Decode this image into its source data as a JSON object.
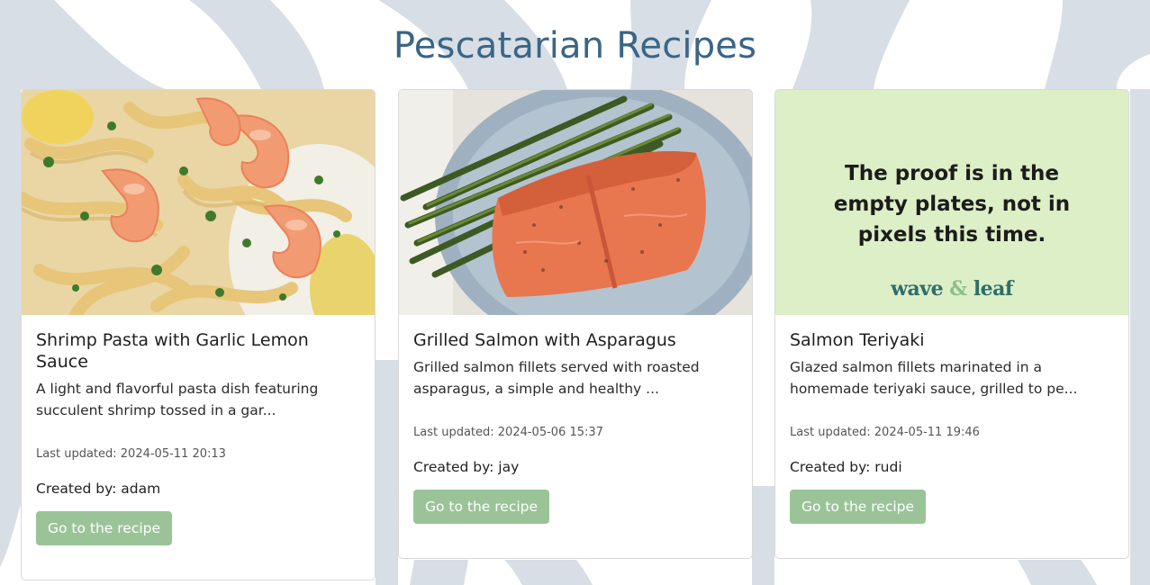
{
  "page": {
    "title": "Pescatarian Recipes"
  },
  "colors": {
    "title": "#3a6587",
    "button": "#9ac498",
    "swoosh": "#d8dee5",
    "promo_bg": "#ddefc6",
    "logo": "#2f6d6d"
  },
  "recipes": [
    {
      "title": "Shrimp Pasta with Garlic Lemon Sauce",
      "description": "A light and flavorful pasta dish featuring succulent shrimp tossed in a gar...",
      "last_updated": "Last updated: 2024-05-11 20:13",
      "created_by": "Created by: adam",
      "button_label": "Go to the recipe"
    },
    {
      "title": "Grilled Salmon with Asparagus",
      "description": "Grilled salmon fillets served with roasted asparagus, a simple and healthy ...",
      "last_updated": "Last updated: 2024-05-06 15:37",
      "created_by": "Created by: jay",
      "button_label": "Go to the recipe"
    },
    {
      "title": "Salmon Teriyaki",
      "description": "Glazed salmon fillets marinated in a homemade teriyaki sauce, grilled to pe...",
      "last_updated": "Last updated: 2024-05-11 19:46",
      "created_by": "Created by: rudi",
      "button_label": "Go to the recipe"
    }
  ],
  "promo": {
    "line1": "The proof is in the",
    "line2": "empty plates, not in",
    "line3": "pixels this time.",
    "logo_word1": "wave",
    "logo_amp": "&",
    "logo_word2": "leaf"
  }
}
